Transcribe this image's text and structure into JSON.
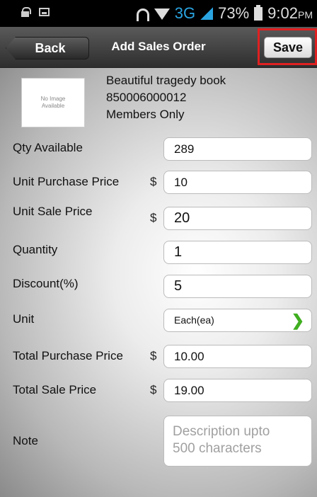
{
  "status_bar": {
    "network": "3G",
    "battery": "73%",
    "time": "9:02",
    "ampm": "PM"
  },
  "header": {
    "back_label": "Back",
    "title": "Add Sales Order",
    "save_label": "Save"
  },
  "product": {
    "image_text_1": "No Image",
    "image_text_2": "Available",
    "name": "Beautiful tragedy book",
    "code": "850006000012",
    "availability": "Members Only"
  },
  "form": {
    "qty_available": {
      "label": "Qty Available",
      "value": "289"
    },
    "unit_purchase_price": {
      "label": "Unit Purchase Price",
      "currency": "$",
      "value": "10"
    },
    "unit_sale_price": {
      "label": "Unit Sale Price",
      "currency": "$",
      "value": "20"
    },
    "quantity": {
      "label": "Quantity",
      "value": "1"
    },
    "discount": {
      "label": "Discount(%)",
      "value": "5"
    },
    "unit": {
      "label": "Unit",
      "value": "Each(ea)"
    },
    "total_purchase_price": {
      "label": "Total Purchase Price",
      "currency": "$",
      "value": "10.00"
    },
    "total_sale_price": {
      "label": "Total Sale Price",
      "currency": "$",
      "value": "19.00"
    },
    "note": {
      "label": "Note",
      "placeholder_1": "Description upto",
      "placeholder_2": "500 characters"
    }
  },
  "icons": {
    "lock": "lock-icon",
    "image": "image-icon",
    "headset": "headset-icon",
    "wifi": "wifi-icon",
    "signal": "signal-icon",
    "battery": "battery-icon",
    "chevron": "chevron-right-icon"
  },
  "colors": {
    "save_highlight": "#e02020",
    "network_accent": "#2aa4e0",
    "chevron": "#3fae1f"
  }
}
